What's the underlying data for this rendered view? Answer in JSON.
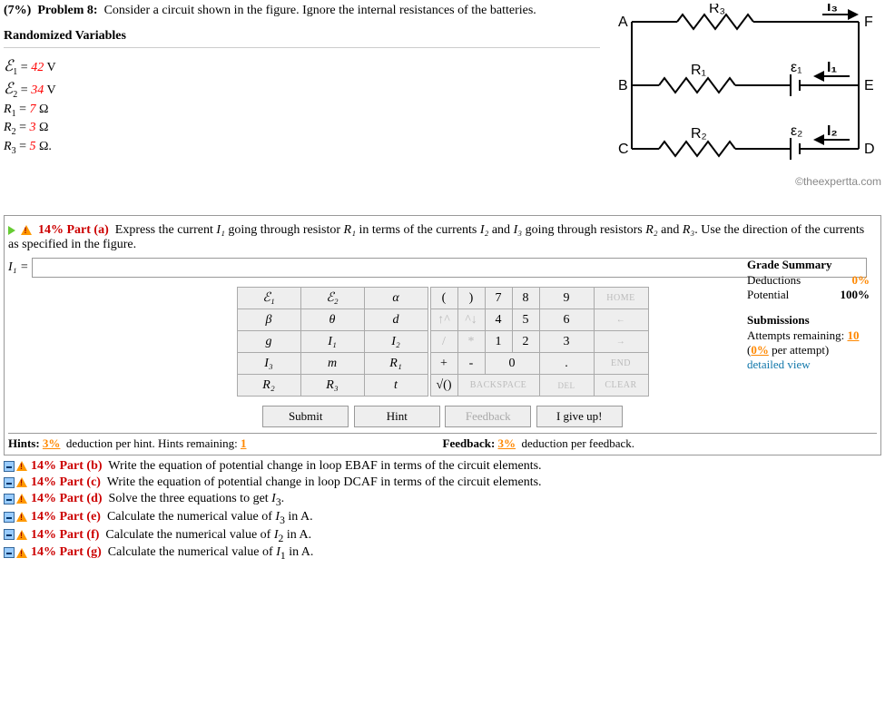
{
  "problem": {
    "weight": "(7%)",
    "label": "Problem 8:",
    "text": "Consider a circuit shown in the figure. Ignore the internal resistances of the batteries.",
    "randomized_heading": "Randomized Variables",
    "vars": {
      "e1": {
        "sym": "ℰ",
        "sub": "1",
        "val": "42",
        "unit": " V"
      },
      "e2": {
        "sym": "ℰ",
        "sub": "2",
        "val": "34",
        "unit": " V"
      },
      "r1": {
        "sym": "R",
        "sub": "1",
        "val": "7",
        "unit": " Ω"
      },
      "r2": {
        "sym": "R",
        "sub": "2",
        "val": "3",
        "unit": " Ω"
      },
      "r3": {
        "sym": "R",
        "sub": "3",
        "val": "5",
        "unit": " Ω."
      }
    }
  },
  "circuit": {
    "nodes": {
      "A": "A",
      "B": "B",
      "C": "C",
      "D": "D",
      "E": "E",
      "F": "F"
    },
    "labels": {
      "R1": "R₁",
      "R2": "R₂",
      "R3": "R₃",
      "e1": "ε₁",
      "e2": "ε₂",
      "I1": "I₁",
      "I2": "I₂",
      "I3": "I₃"
    },
    "copyright": "©theexpertta.com"
  },
  "part_a": {
    "label": "14% Part (a)",
    "text1": "Express the current ",
    "i1": "I₁",
    "text2": " going through resistor ",
    "r1": "R₁",
    "text3": " in terms of the currents ",
    "i2": "I₂",
    "text4": " and ",
    "i3": "I₃",
    "text5": " going through resistors ",
    "r2": "R₂",
    "text6": " and ",
    "r3": "R₃",
    "text7": ". Use the direction of the currents as specified in the figure.",
    "lhs": "I₁ = "
  },
  "keypad": {
    "sym": [
      [
        "ℰ₁",
        "ℰ₂",
        "α"
      ],
      [
        "β",
        "θ",
        "d"
      ],
      [
        "g",
        "I₁",
        "I₂"
      ],
      [
        "I₃",
        "m",
        "R₁"
      ],
      [
        "R₂",
        "R₃",
        "t"
      ]
    ],
    "num": [
      [
        "(",
        ")",
        "7",
        "8",
        "9",
        "HOME"
      ],
      [
        "↑^",
        "^↓",
        "4",
        "5",
        "6",
        "←"
      ],
      [
        "/",
        "*",
        "1",
        "2",
        "3",
        "→"
      ],
      [
        "+",
        "-",
        "0",
        ".",
        "END"
      ],
      [
        "√()",
        "BACKSPACE",
        "DEL",
        "CLEAR"
      ]
    ]
  },
  "buttons": {
    "submit": "Submit",
    "hint": "Hint",
    "feedback": "Feedback",
    "giveup": "I give up!"
  },
  "hints": {
    "label": "Hints:",
    "ded": "3%",
    "text": "deduction per hint. Hints remaining:",
    "remaining": "1",
    "fb_label": "Feedback:",
    "fb_ded": "3%",
    "fb_text": "deduction per feedback."
  },
  "grade": {
    "heading": "Grade Summary",
    "ded_label": "Deductions",
    "ded_val": "0%",
    "pot_label": "Potential",
    "pot_val": "100%",
    "sub_heading": "Submissions",
    "att_label": "Attempts remaining:",
    "att_val": "10",
    "per_attempt_pre": "(",
    "per_attempt_pct": "0%",
    "per_attempt_post": " per attempt)",
    "detailed": "detailed view"
  },
  "other_parts": {
    "b": {
      "label": "14% Part (b)",
      "text": "Write the equation of potential change in loop EBAF in terms of the circuit elements."
    },
    "c": {
      "label": "14% Part (c)",
      "text": "Write the equation of potential change in loop DCAF in terms of the circuit elements."
    },
    "d": {
      "label": "14% Part (d)",
      "text": "Solve the three equations to get I₃.",
      "sfx": ""
    },
    "e": {
      "label": "14% Part (e)",
      "text": "Calculate the numerical value of I₃ in A.",
      "sfx": ""
    },
    "f": {
      "label": "14% Part (f)",
      "text": "Calculate the numerical value of I₂ in A.",
      "sfx": ""
    },
    "g": {
      "label": "14% Part (g)",
      "text": "Calculate the numerical value of I₁ in A.",
      "sfx": ""
    }
  }
}
